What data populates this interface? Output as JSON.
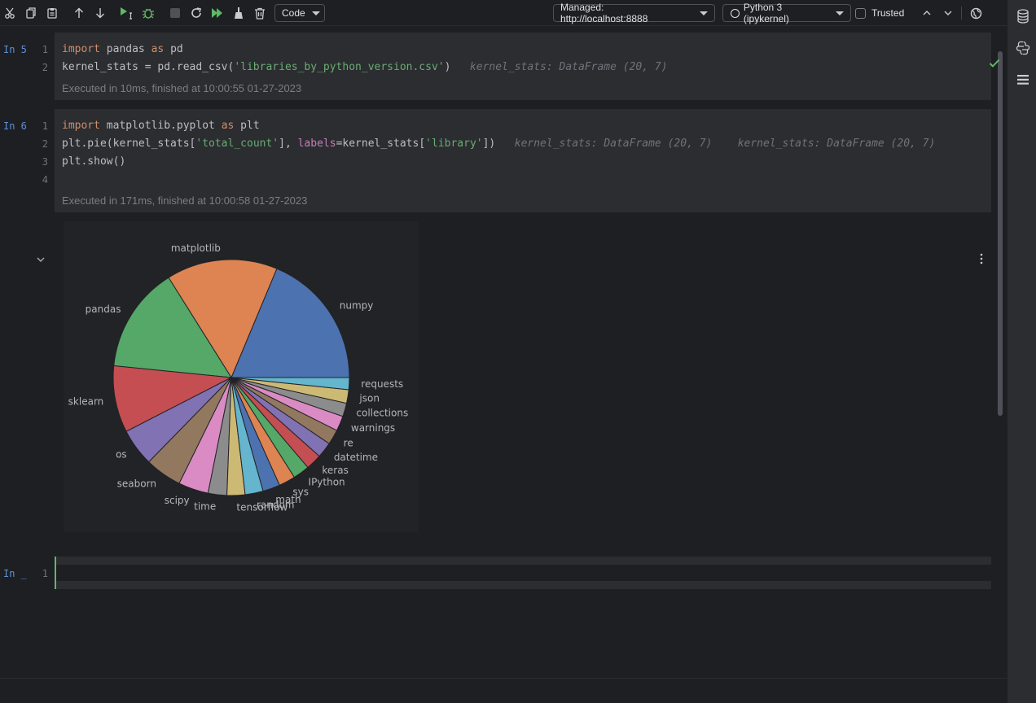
{
  "toolbar": {
    "cell_type": "Code",
    "server": "Managed: http://localhost:8888",
    "kernel": "Python 3 (ipykernel)",
    "trusted_label": "Trusted",
    "icons": [
      "cut-icon",
      "copy-icon",
      "paste-icon",
      "move-up-icon",
      "move-down-icon",
      "run-cell-icon",
      "debug-icon",
      "stop-icon",
      "restart-icon",
      "run-all-icon",
      "clean-icon",
      "delete-icon",
      "arrow-up-icon",
      "arrow-down-icon",
      "globe-icon"
    ]
  },
  "right_sidebar": {
    "icons": [
      "database-icon",
      "python-console-icon",
      "list-icon"
    ]
  },
  "cells": [
    {
      "prompt": "In 5",
      "lines": [
        "1",
        "2"
      ],
      "code": {
        "l1_kw1": "import",
        "l1_mod": "pandas",
        "l1_kw2": "as",
        "l1_alias": "pd",
        "l2_a": "kernel_stats = pd.read_csv(",
        "l2_str": "'libraries_by_python_version.csv'",
        "l2_b": ")",
        "l2_hint": "kernel_stats: DataFrame (20, 7)"
      },
      "exec": "Executed in 10ms, finished at 10:00:55 01-27-2023"
    },
    {
      "prompt": "In 6",
      "lines": [
        "1",
        "2",
        "3",
        "4"
      ],
      "code": {
        "l1_kw1": "import",
        "l1_mod": "matplotlib.pyplot",
        "l1_kw2": "as",
        "l1_alias": "plt",
        "l2_a": "plt.pie(kernel_stats[",
        "l2_str1": "'total_count'",
        "l2_b": "], ",
        "l2_param": "labels",
        "l2_c": "=kernel_stats[",
        "l2_str2": "'library'",
        "l2_d": "])",
        "l2_hint1": "kernel_stats: DataFrame (20, 7)",
        "l2_hint2": "kernel_stats: DataFrame (20, 7)",
        "l3": "plt.show()"
      },
      "exec": "Executed in 171ms, finished at 10:00:58 01-27-2023"
    },
    {
      "prompt": "In _",
      "lines": [
        "1"
      ]
    }
  ],
  "chart_data": {
    "type": "pie",
    "title": "",
    "categories": [
      "numpy",
      "matplotlib",
      "pandas",
      "sklearn",
      "os",
      "seaborn",
      "scipy",
      "time",
      "tensorflow",
      "random",
      "math",
      "sys",
      "IPython",
      "keras",
      "datetime",
      "re",
      "warnings",
      "collections",
      "json",
      "requests"
    ],
    "values": [
      18.2,
      14.8,
      14.1,
      8.9,
      5.0,
      4.9,
      4.0,
      2.5,
      2.4,
      2.4,
      2.3,
      2.2,
      2.2,
      2.1,
      2.1,
      2.0,
      2.0,
      1.8,
      1.8,
      1.6
    ],
    "colors": [
      "#4c72b0",
      "#dd8452",
      "#55a868",
      "#c44e52",
      "#8172b3",
      "#937860",
      "#da8bc3",
      "#8c8c8c",
      "#ccb974",
      "#64b5cd"
    ]
  }
}
